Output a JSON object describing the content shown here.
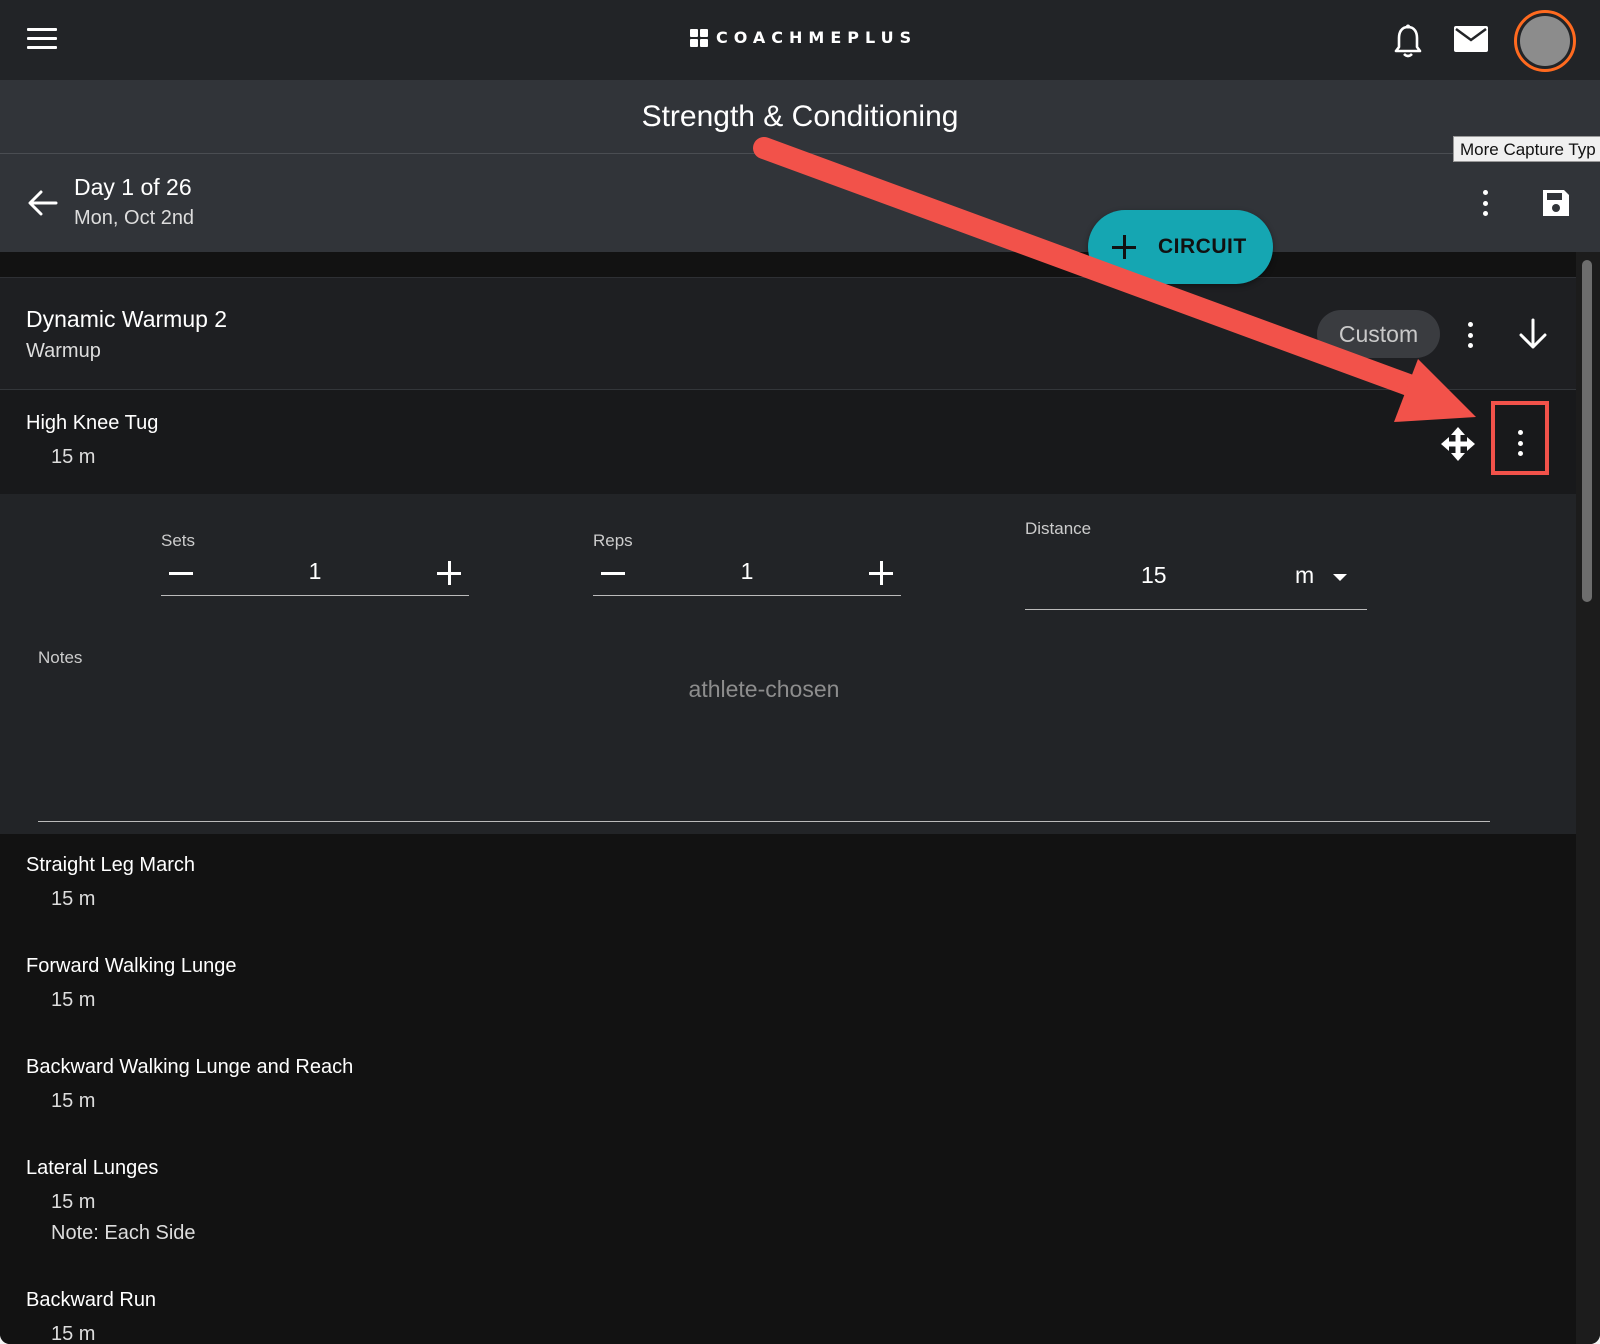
{
  "header": {
    "logo_text": "COACHMEPLUS",
    "icons": [
      "menu-icon",
      "bell-icon",
      "mail-icon",
      "avatar"
    ],
    "accent_color": "#ff6a1f"
  },
  "title_bar": {
    "title": "Strength & Conditioning",
    "tooltip": "More Capture Typ"
  },
  "day_bar": {
    "day": "Day 1 of 26",
    "date": "Mon, Oct 2nd"
  },
  "circuit_button": {
    "label": "CIRCUIT",
    "color": "#15a6b2"
  },
  "block": {
    "title": "Dynamic Warmup 2",
    "subtitle": "Warmup",
    "chip": "Custom"
  },
  "selected_exercise": {
    "name": "High Knee Tug",
    "distance": "15 m",
    "sets_label": "Sets",
    "sets_value": "1",
    "reps_label": "Reps",
    "reps_value": "1",
    "distance_label": "Distance",
    "distance_value": "15",
    "distance_unit": "m",
    "notes_label": "Notes",
    "notes_placeholder": "athlete-chosen"
  },
  "exercises": [
    {
      "name": "Straight Leg March",
      "distance": "15 m",
      "note": ""
    },
    {
      "name": "Forward Walking Lunge",
      "distance": "15 m",
      "note": ""
    },
    {
      "name": "Backward Walking Lunge and Reach",
      "distance": "15 m",
      "note": ""
    },
    {
      "name": "Lateral Lunges",
      "distance": "15 m",
      "note": "Note: Each Side"
    },
    {
      "name": "Backward Run",
      "distance": "15 m",
      "note": ""
    }
  ],
  "annotation": {
    "arrow_color": "#f2524a"
  }
}
